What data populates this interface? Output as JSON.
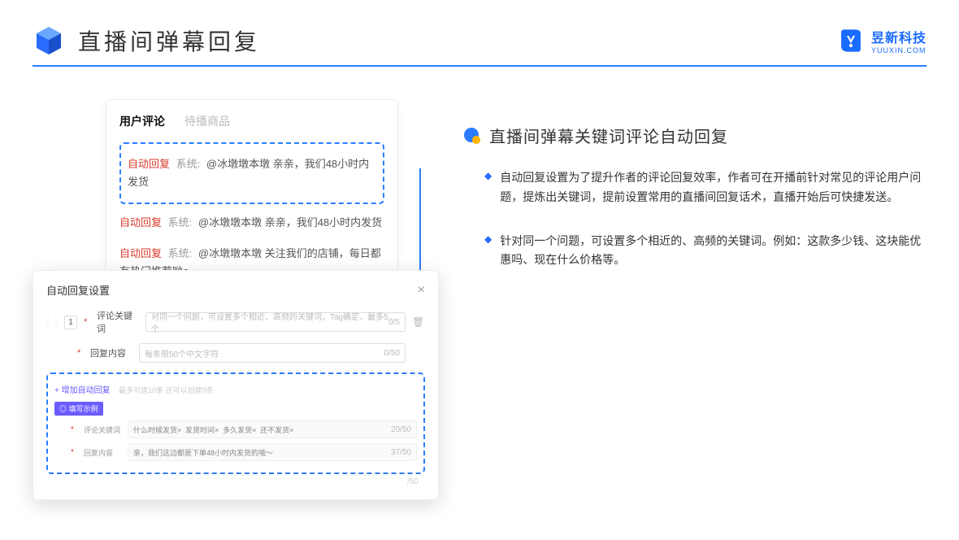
{
  "header": {
    "title": "直播间弹幕回复",
    "brand_cn": "昱新科技",
    "brand_en": "YUUXIN.COM"
  },
  "comments": {
    "tabs": {
      "active": "用户评论",
      "inactive": "待播商品"
    },
    "rows": [
      {
        "tag": "自动回复",
        "sys": "系统:",
        "body": "@冰墩墩本墩 亲亲，我们48小时内发货"
      },
      {
        "tag": "自动回复",
        "sys": "系统:",
        "body": "@冰墩墩本墩 亲亲，我们48小时内发货"
      },
      {
        "tag": "自动回复",
        "sys": "系统:",
        "body": "@冰墩墩本墩 关注我们的店铺，每日都有热门推荐呦～"
      }
    ]
  },
  "settings": {
    "title": "自动回复设置",
    "index": "1",
    "kw_label": "评论关键词",
    "kw_placeholder": "对同一个问题，可设置多个相近、高频的关键词，Tag确定，最多5个",
    "kw_count": "0/5",
    "content_label": "回复内容",
    "content_placeholder": "每条限50个中文字符",
    "content_count": "0/50",
    "add_link": "+ 增加自动回复",
    "add_hint": "最多可建10条 还可以创建9条",
    "example_badge": "◎ 填写示例",
    "ex_kw_label": "评论关键词",
    "ex_tags": [
      "什么时候发货×",
      "发货时间×",
      "多久发货×",
      "还不发货×"
    ],
    "ex_kw_count": "20/50",
    "ex_content_label": "回复内容",
    "ex_content_text": "亲，我们这边都是下单48小时内发货的哦～",
    "ex_content_count": "37/50",
    "outer_count": "/50"
  },
  "feature": {
    "title": "直播间弹幕关键词评论自动回复",
    "bullets": [
      "自动回复设置为了提升作者的评论回复效率，作者可在开播前针对常见的评论用户问题，提炼出关键词，提前设置常用的直播间回复话术，直播开始后可快捷发送。",
      "针对同一个问题，可设置多个相近的、高频的关键词。例如：这款多少钱、这块能优惠吗、现在什么价格等。"
    ]
  }
}
